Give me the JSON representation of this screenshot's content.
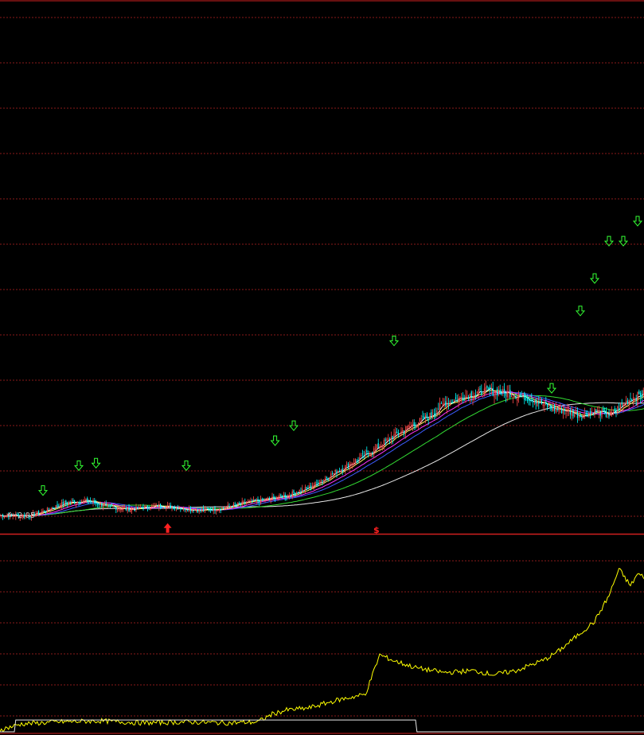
{
  "chart_data": [
    {
      "type": "candlestick",
      "panel": "price",
      "title": "",
      "xlabel": "",
      "ylabel": "",
      "grid": true,
      "low_marker_label": "2.05",
      "event_marker_label": "$",
      "colors": {
        "up": "#ff4a4a",
        "down": "#00ffff",
        "grid": "#8a1a1a",
        "border": "#d11f1f",
        "ma_short": "#ffffff",
        "ma_mid": "#ffff66",
        "ma_magenta": "#ff33ff",
        "ma_blue": "#3c5cff",
        "ma_green": "#33dd33",
        "ma_long": "#e8e8e8",
        "signal_arrow": "#33ff33",
        "buy_arrow": "#ff2020",
        "low_label": "#c0c0c0"
      },
      "ylim": [
        1.85,
        12.5
      ],
      "keypoints": [
        [
          0,
          2.2
        ],
        [
          20,
          2.2
        ],
        [
          30,
          2.28
        ],
        [
          45,
          2.45
        ],
        [
          60,
          2.5
        ],
        [
          75,
          2.38
        ],
        [
          90,
          2.32
        ],
        [
          110,
          2.4
        ],
        [
          125,
          2.35
        ],
        [
          140,
          2.3
        ],
        [
          155,
          2.35
        ],
        [
          170,
          2.45
        ],
        [
          185,
          2.52
        ],
        [
          200,
          2.6
        ],
        [
          215,
          2.75
        ],
        [
          230,
          3.0
        ],
        [
          245,
          3.25
        ],
        [
          260,
          3.5
        ],
        [
          275,
          3.8
        ],
        [
          290,
          4.05
        ],
        [
          300,
          4.2
        ],
        [
          310,
          4.45
        ],
        [
          325,
          4.6
        ],
        [
          340,
          4.7
        ],
        [
          355,
          4.65
        ],
        [
          370,
          4.55
        ],
        [
          385,
          4.35
        ],
        [
          395,
          4.3
        ],
        [
          405,
          4.2
        ],
        [
          415,
          4.3
        ],
        [
          425,
          4.2
        ],
        [
          440,
          4.55
        ],
        [
          455,
          4.7
        ],
        [
          465,
          4.55
        ],
        [
          475,
          4.7
        ],
        [
          490,
          5.4
        ],
        [
          505,
          6.1
        ],
        [
          515,
          5.8
        ],
        [
          530,
          6.3
        ],
        [
          545,
          7.3
        ],
        [
          555,
          8.0
        ],
        [
          565,
          8.5
        ],
        [
          575,
          8.7
        ],
        [
          585,
          8.2
        ],
        [
          595,
          8.4
        ],
        [
          605,
          8.0
        ]
      ],
      "signal_arrows": [
        [
          30,
          2.7
        ],
        [
          55,
          3.2
        ],
        [
          67,
          3.25
        ],
        [
          130,
          3.2
        ],
        [
          192,
          3.7
        ],
        [
          205,
          4.0
        ],
        [
          275,
          5.7
        ],
        [
          385,
          4.75
        ],
        [
          405,
          6.3
        ],
        [
          415,
          6.95
        ],
        [
          425,
          7.7
        ],
        [
          435,
          7.7
        ],
        [
          445,
          8.1
        ]
      ],
      "buy_arrows": [
        [
          117,
          1.95
        ]
      ],
      "low_marker_index": 2
    },
    {
      "type": "line",
      "panel": "indicator",
      "title": "",
      "xlabel": "",
      "ylabel": "",
      "grid": true,
      "ylim": [
        0,
        200
      ],
      "series": [
        {
          "color": "#ffff00",
          "keypoints": [
            [
              0,
              2
            ],
            [
              15,
              8
            ],
            [
              40,
              10
            ],
            [
              70,
              11
            ],
            [
              100,
              9
            ],
            [
              130,
              10
            ],
            [
              160,
              9
            ],
            [
              180,
              10
            ],
            [
              190,
              18
            ],
            [
              200,
              22
            ],
            [
              215,
              24
            ],
            [
              235,
              32
            ],
            [
              255,
              38
            ],
            [
              265,
              78
            ],
            [
              275,
              72
            ],
            [
              290,
              65
            ],
            [
              310,
              60
            ],
            [
              330,
              62
            ],
            [
              345,
              58
            ],
            [
              360,
              62
            ],
            [
              380,
              73
            ],
            [
              390,
              82
            ],
            [
              405,
              100
            ],
            [
              415,
              112
            ],
            [
              425,
              138
            ],
            [
              432,
              165
            ],
            [
              440,
              148
            ],
            [
              445,
              160
            ],
            [
              452,
              155
            ]
          ]
        },
        {
          "color": "#e8e8e8",
          "keypoints": [
            [
              0,
              0
            ],
            [
              10,
              0
            ],
            [
              11,
              12
            ],
            [
              290,
              12
            ],
            [
              291,
              0
            ],
            [
              452,
              0
            ]
          ]
        }
      ]
    }
  ]
}
